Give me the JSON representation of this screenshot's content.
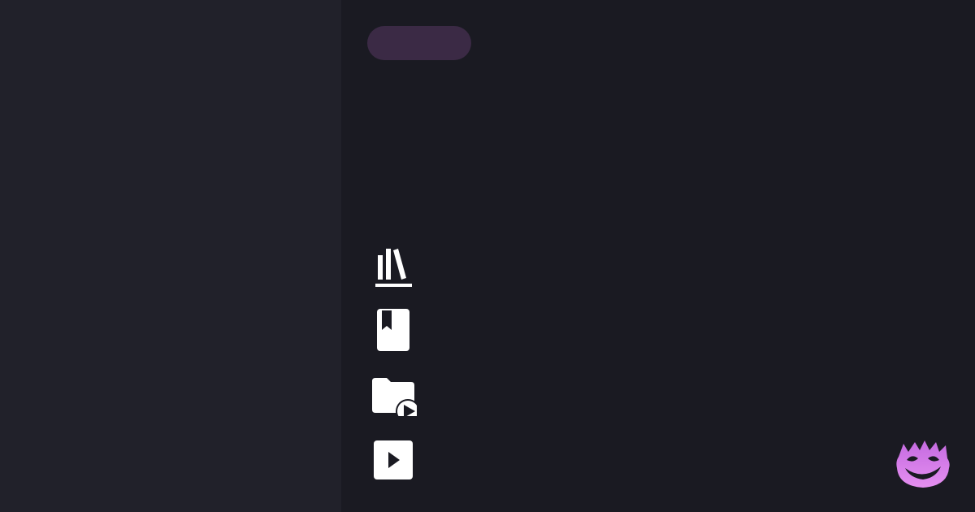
{
  "header": {
    "pill_label": ""
  },
  "nav": {
    "items": [
      {
        "icon": "library-icon",
        "label": ""
      },
      {
        "icon": "bookmark-book-icon",
        "label": ""
      },
      {
        "icon": "media-folder-icon",
        "label": ""
      },
      {
        "icon": "play-icon",
        "label": ""
      }
    ]
  },
  "brand": {
    "logo_icon": "purple-grinning-mascot-icon"
  },
  "colors": {
    "sidebar_bg": "#21212a",
    "main_bg": "#1a1a22",
    "pill_bg": "#3b2a45",
    "icon": "#ffffff",
    "brand_purple": "#d57fe8"
  }
}
